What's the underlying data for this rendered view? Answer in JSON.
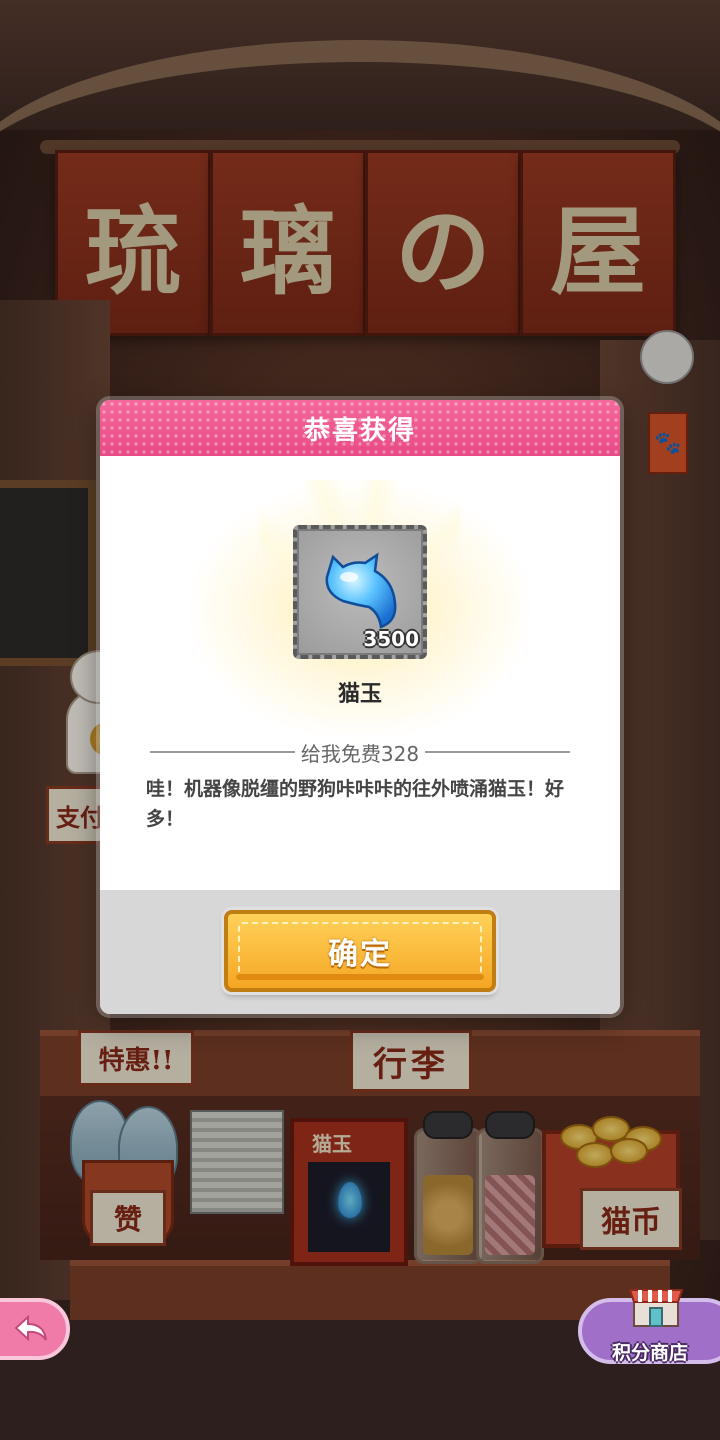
{
  "background": {
    "noren_chars": [
      "琉",
      "璃",
      "の",
      "屋"
    ],
    "signs": {
      "tehui": "特惠!!",
      "xingli": "行李",
      "maobi": "猫币",
      "zhi": "支付",
      "zan": "赞",
      "maoyu_tag": "猫玉"
    }
  },
  "modal": {
    "title": "恭喜获得",
    "item": {
      "icon": "cat-gem-icon",
      "quantity": "3500",
      "name": "猫玉"
    },
    "source": "给我免费328",
    "description": "哇！机器像脱缰的野狗咔咔咔的往外喷涌猫玉！好多！",
    "confirm_label": "确定"
  },
  "nav": {
    "back_icon": "back-arrow-icon",
    "shop_label": "积分商店",
    "shop_icon": "shop-icon"
  },
  "colors": {
    "header_pink": "#e84a86",
    "button_orange": "#f5a623",
    "item_blue": "#3aa6f0"
  }
}
